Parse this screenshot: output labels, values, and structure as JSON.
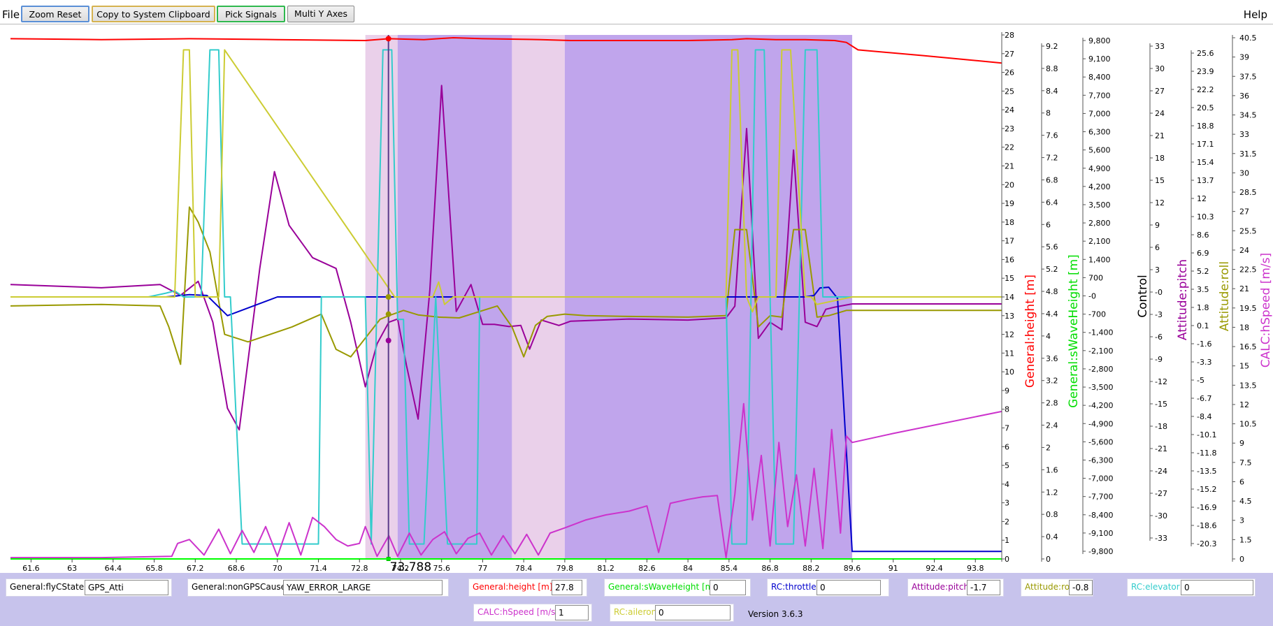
{
  "menu": {
    "file": "File",
    "help": "Help"
  },
  "toolbar": {
    "zoom_reset": "Zoom Reset",
    "copy": "Copy to System Clipboard",
    "pick": "Pick Signals",
    "multi": "Multi Y Axes"
  },
  "cursor": {
    "label": "73.788"
  },
  "x_axis": {
    "ticks": [
      "61.6",
      "63",
      "64.4",
      "65.8",
      "67.2",
      "68.6",
      "70",
      "71.4",
      "72.8",
      "74.2",
      "75.6",
      "77",
      "78.4",
      "79.8",
      "81.2",
      "82.6",
      "84",
      "85.4",
      "86.8",
      "88.2",
      "89.6",
      "91",
      "92.4",
      "93.8"
    ]
  },
  "axes": [
    {
      "name": "General:height [m]",
      "color": "#ff0000",
      "ticks": [
        "28",
        "27",
        "26",
        "25",
        "24",
        "23",
        "22",
        "21",
        "20",
        "19",
        "18",
        "17",
        "16",
        "15",
        "14",
        "13",
        "12",
        "11",
        "10",
        "9",
        "8",
        "7",
        "6",
        "5",
        "4",
        "3",
        "2",
        "1",
        "0"
      ]
    },
    {
      "name": "",
      "color": "#ff0000",
      "ticks": [
        "9.2",
        "8.8",
        "8.4",
        "8",
        "7.6",
        "7.2",
        "6.8",
        "6.4",
        "6",
        "5.6",
        "5.2",
        "4.8",
        "4.4",
        "4",
        "3.6",
        "3.2",
        "2.8",
        "2.4",
        "2",
        "1.6",
        "1.2",
        "0.8",
        "0.4",
        "0"
      ]
    },
    {
      "name": "General:sWaveHeight [m]",
      "color": "#00dd00",
      "ticks": [
        "9,800",
        "9,100",
        "8,400",
        "7,700",
        "7,000",
        "6,300",
        "5,600",
        "4,900",
        "4,200",
        "3,500",
        "2,800",
        "2,100",
        "1,400",
        "700",
        "-0",
        "-700",
        "-1,400",
        "-2,100",
        "-2,800",
        "-3,500",
        "-4,200",
        "-4,900",
        "-5,600",
        "-6,300",
        "-7,000",
        "-7,700",
        "-8,400",
        "-9,100",
        "-9,800"
      ]
    },
    {
      "name": "Control",
      "color": "#000000",
      "ticks": [
        "33",
        "30",
        "27",
        "24",
        "21",
        "18",
        "15",
        "12",
        "9",
        "6",
        "3",
        "-0",
        "-3",
        "-6",
        "-9",
        "-12",
        "-15",
        "-18",
        "-21",
        "-24",
        "-27",
        "-30",
        "-33"
      ]
    },
    {
      "name": "Attitude:pitch",
      "color": "#990099",
      "ticks": [
        "25.6",
        "23.9",
        "22.2",
        "20.5",
        "18.8",
        "17.1",
        "15.4",
        "13.7",
        "12",
        "10.3",
        "8.6",
        "6.9",
        "5.2",
        "3.5",
        "1.8",
        "0.1",
        "-1.6",
        "-3.3",
        "-5",
        "-6.7",
        "-8.4",
        "-10.1",
        "-11.8",
        "-13.5",
        "-15.2",
        "-16.9",
        "-18.6",
        "-20.3"
      ]
    },
    {
      "name": "Attitude:roll",
      "color": "#999900",
      "ticks": []
    },
    {
      "name": "CALC:hSpeed [m/s]",
      "color": "#cc33cc",
      "ticks": [
        "40.5",
        "39",
        "37.5",
        "36",
        "34.5",
        "33",
        "31.5",
        "30",
        "28.5",
        "27",
        "25.5",
        "24",
        "22.5",
        "21",
        "19.5",
        "18",
        "16.5",
        "15",
        "13.5",
        "12",
        "10.5",
        "9",
        "7.5",
        "6",
        "4.5",
        "3",
        "1.5",
        "0"
      ]
    }
  ],
  "fields": [
    {
      "label": "General:flyCState",
      "value": "GPS_Atti",
      "color": "#000000"
    },
    {
      "label": "General:nonGPSCause",
      "value": "YAW_ERROR_LARGE",
      "color": "#000000"
    },
    {
      "label": "General:height [m]",
      "value": "27.8",
      "color": "#ff0000"
    },
    {
      "label": "General:sWaveHeight [m]",
      "value": "0",
      "color": "#00dd00"
    },
    {
      "label": "RC:throttle",
      "value": "0",
      "color": "#0000cc"
    },
    {
      "label": "Attitude:pitch",
      "value": "-1.7",
      "color": "#990099"
    },
    {
      "label": "Attitude:roll",
      "value": "-0.8",
      "color": "#999900"
    },
    {
      "label": "RC:elevator",
      "value": "0",
      "color": "#33cccc"
    },
    {
      "label": "CALC:hSpeed [m/s]",
      "value": "1",
      "color": "#cc33cc"
    },
    {
      "label": "RC:aileron",
      "value": "0",
      "color": "#cccc33"
    }
  ],
  "version": "Version 3.6.3",
  "chart_data": {
    "type": "line",
    "x_range": [
      60.9,
      94.7
    ],
    "cursor_x": 73.788,
    "shaded_regions": [
      {
        "x": [
          73.0,
          74.1
        ],
        "color": "#ead0ea"
      },
      {
        "x": [
          74.1,
          78.0
        ],
        "color": "#c0a5ec"
      },
      {
        "x": [
          78.0,
          79.8
        ],
        "color": "#ead0ea"
      },
      {
        "x": [
          79.8,
          89.6
        ],
        "color": "#c0a5ec"
      }
    ],
    "series": [
      {
        "name": "General:height [m]",
        "color": "#ff0000",
        "x": [
          60.9,
          64,
          67,
          70,
          73,
          73.8,
          75,
          76,
          77,
          79,
          80,
          82,
          84,
          85.5,
          86,
          87,
          88,
          89,
          89.4,
          89.8,
          92,
          94.7
        ],
        "y": [
          27.8,
          27.75,
          27.8,
          27.75,
          27.7,
          27.8,
          27.75,
          27.85,
          27.8,
          27.75,
          27.7,
          27.7,
          27.7,
          27.75,
          27.8,
          27.75,
          27.75,
          27.7,
          27.6,
          27.2,
          26.9,
          26.5
        ]
      },
      {
        "name": "Attitude:pitch",
        "color": "#990099",
        "x": [
          60.9,
          64,
          66,
          66.7,
          67.3,
          67.8,
          68.3,
          68.7,
          69.4,
          69.9,
          70.4,
          71.2,
          72,
          72.5,
          73,
          73.4,
          73.8,
          74.1,
          74.4,
          74.8,
          75.2,
          75.6,
          76.1,
          76.6,
          77.0,
          77.4,
          77.9,
          78.3,
          78.6,
          79.0,
          79.6,
          80,
          82,
          84,
          85.3,
          85.6,
          86.0,
          86.4,
          86.8,
          87.2,
          87.6,
          88.0,
          88.4,
          88.7,
          89.0,
          89.6,
          91,
          94.7
        ],
        "y": [
          3.5,
          3.2,
          3.5,
          2.5,
          3.8,
          0,
          -8,
          -10,
          5,
          14,
          9,
          6,
          5,
          0,
          -6,
          -2,
          0,
          0.3,
          -4,
          -9,
          3,
          22,
          1,
          3.5,
          -0.2,
          -0.2,
          -0.4,
          -0.3,
          -2.5,
          0.2,
          -0.3,
          0.1,
          0.3,
          0.2,
          0.4,
          1.5,
          18,
          -1.5,
          0,
          -0.7,
          16,
          0,
          -0.4,
          1.2,
          1.4,
          1.7,
          1.7,
          1.7
        ]
      },
      {
        "name": "Attitude:roll",
        "color": "#999900",
        "x": [
          60.9,
          64,
          66.0,
          66.3,
          66.7,
          67.0,
          67.3,
          67.7,
          68.2,
          69.0,
          70.5,
          71.5,
          72.0,
          72.5,
          73.5,
          73.8,
          74.3,
          74.8,
          75.5,
          76.2,
          77.5,
          78.0,
          78.4,
          78.8,
          79.2,
          79.8,
          80.5,
          82,
          84,
          85.3,
          85.6,
          86,
          86.4,
          86.8,
          87.2,
          87.6,
          88,
          88.4,
          88.8,
          89.4,
          89.6,
          94.7
        ],
        "y": [
          -1.2,
          -1.0,
          -1.2,
          -4,
          -9,
          12,
          10,
          6,
          -5,
          -6,
          -4,
          -2.3,
          -7,
          -8,
          -3,
          -2.5,
          -1.8,
          -2.4,
          -2.7,
          -2.8,
          -1.2,
          -4,
          -8,
          -3.8,
          -2.6,
          -2.3,
          -2.5,
          -2.6,
          -2.7,
          -2.5,
          9,
          9,
          -4,
          -2.5,
          -2.7,
          9,
          9,
          -2.7,
          -2.5,
          -1.8,
          -1.8,
          -1.8
        ]
      },
      {
        "name": "RC:throttle",
        "color": "#0000cc",
        "x": [
          60.9,
          65.5,
          66.2,
          67.0,
          67.6,
          68.3,
          70,
          73.5,
          79.8,
          85.5,
          85.9,
          88,
          88.3,
          88.5,
          88.8,
          89.1,
          89.6,
          94.7
        ],
        "y": [
          0,
          0,
          0,
          0.3,
          0.2,
          -2.5,
          0,
          0,
          0,
          0,
          0,
          0,
          0.2,
          1.2,
          1.3,
          -0.2,
          -34,
          -34
        ]
      },
      {
        "name": "RC:elevator",
        "color": "#33cccc",
        "x": [
          60.9,
          65.6,
          66.2,
          66.5,
          66.8,
          67.4,
          67.7,
          68.0,
          68.2,
          68.4,
          68.8,
          69.0,
          71.4,
          71.5,
          72.5,
          73.0,
          73.2,
          73.6,
          73.9,
          74.1,
          74.3,
          74.5,
          75.0,
          75.4,
          75.8,
          76.0,
          76.8,
          76.9,
          85.3,
          85.5,
          86.0,
          86.3,
          86.6,
          87.0,
          87.2,
          87.6,
          88.0,
          88.4,
          88.6,
          88.9,
          94.7
        ],
        "y": [
          0,
          0,
          0.5,
          0.8,
          0,
          0,
          33,
          33,
          0,
          0,
          -33,
          -33,
          -33,
          0,
          0,
          0,
          -33,
          33,
          33,
          -3,
          -3,
          -33,
          -33,
          0,
          -33,
          -33,
          -33,
          0,
          0,
          -33,
          -33,
          33,
          33,
          -33,
          -33,
          -33,
          33,
          33,
          0,
          0,
          0
        ]
      },
      {
        "name": "RC:aileron",
        "color": "#cccc33",
        "x": [
          60.9,
          66.5,
          66.8,
          67.0,
          67.2,
          67.7,
          68.0,
          68.2,
          74,
          75.3,
          75.5,
          75.7,
          76.0,
          85.3,
          85.5,
          85.7,
          86.0,
          86.2,
          86.4,
          87.0,
          87.2,
          87.5,
          88.0,
          88.2,
          88.4,
          89.6,
          94.7
        ],
        "y": [
          0,
          0,
          33,
          33,
          0,
          0,
          0,
          33,
          0,
          0,
          2,
          -1,
          0,
          0,
          33,
          33,
          0,
          -2,
          0,
          0,
          33,
          33,
          0,
          0,
          -1,
          0,
          0
        ]
      },
      {
        "name": "CALC:hSpeed [m/s]",
        "color": "#cc33cc",
        "x": [
          60.9,
          64,
          66.4,
          66.6,
          67,
          67.5,
          68.0,
          68.4,
          68.8,
          69.2,
          69.6,
          70.0,
          70.4,
          70.8,
          71.2,
          71.6,
          72.0,
          72.4,
          72.8,
          73.0,
          73.4,
          73.8,
          74.1,
          74.5,
          74.9,
          75.3,
          75.7,
          76.1,
          76.5,
          76.9,
          77.3,
          77.7,
          78.1,
          78.5,
          78.9,
          79.3,
          79.8,
          80.5,
          81.2,
          82.0,
          82.6,
          83.0,
          83.4,
          84.0,
          84.5,
          85.0,
          85.3,
          85.6,
          85.9,
          86.2,
          86.5,
          86.8,
          87.1,
          87.4,
          87.7,
          88.0,
          88.3,
          88.6,
          88.9,
          89.2,
          89.4,
          89.6,
          91,
          94.7
        ],
        "y": [
          0.1,
          0.1,
          0.2,
          1.2,
          1.5,
          0.3,
          2.3,
          0.4,
          2.2,
          0.5,
          2.5,
          0.2,
          2.8,
          0.3,
          3.2,
          2.5,
          1.5,
          1,
          1.2,
          2.5,
          0.2,
          1.8,
          0.2,
          2.0,
          0.3,
          1.5,
          2.1,
          0.4,
          1.6,
          2.0,
          0.3,
          1.8,
          0.4,
          1.9,
          0.3,
          2.0,
          2.4,
          3.0,
          3.4,
          3.7,
          4.1,
          0.5,
          4.3,
          4.6,
          4.8,
          4.9,
          0.1,
          5.0,
          12.0,
          3.0,
          8.0,
          1.0,
          9.0,
          2.5,
          6.5,
          1.0,
          7.0,
          0.8,
          10.0,
          2.0,
          9.5,
          9.0,
          9.7,
          11.4
        ]
      },
      {
        "name": "General:sWaveHeight [m]",
        "color": "#00dd00",
        "x": [
          60.9,
          94.7
        ],
        "y": [
          -9800,
          -9800
        ]
      }
    ]
  }
}
